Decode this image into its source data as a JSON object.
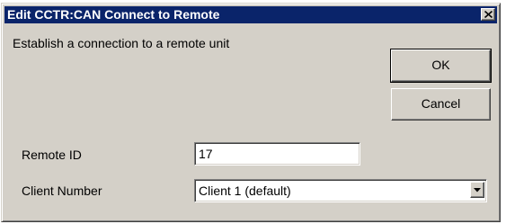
{
  "window": {
    "title": "Edit CCTR:CAN Connect to Remote"
  },
  "description": "Establish a connection to a remote unit",
  "buttons": {
    "ok_label": "OK",
    "cancel_label": "Cancel"
  },
  "fields": {
    "remote_id_label": "Remote ID",
    "remote_id_value": "17",
    "client_number_label": "Client Number",
    "client_number_value": "Client 1 (default)"
  },
  "icons": {
    "close": "close-icon",
    "dropdown": "chevron-down-icon"
  },
  "colors": {
    "titlebar": "#0a246a",
    "face": "#d4d0c8"
  }
}
